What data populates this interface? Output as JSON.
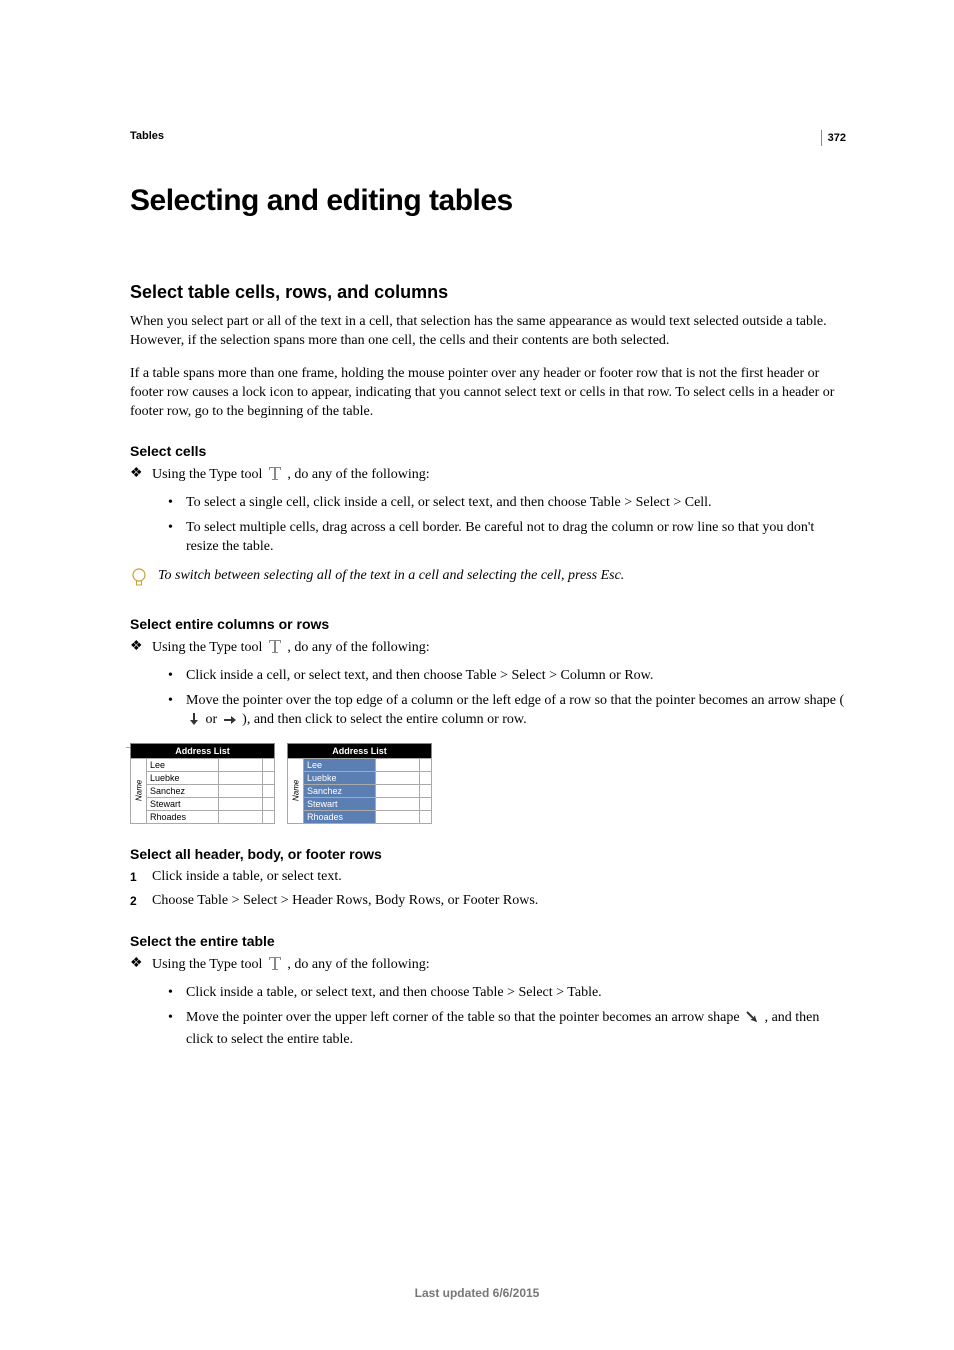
{
  "page_number": "372",
  "breadcrumb": "Tables",
  "h1": "Selecting and editing tables",
  "h2": "Select table cells, rows, and columns",
  "intro_p1": "When you select part or all of the text in a cell, that selection has the same appearance as would text selected outside a table. However, if the selection spans more than one cell, the cells and their contents are both selected.",
  "intro_p2": "If a table spans more than one frame, holding the mouse pointer over any header or footer row that is not the first header or footer row causes a lock icon to appear, indicating that you cannot select text or cells in that row. To select cells in a header or footer row, go to the beginning of the table.",
  "sections": {
    "select_cells": {
      "title": "Select cells",
      "lead_pre": "Using the Type tool ",
      "lead_post": " , do any of the following:",
      "b1": "To select a single cell, click inside a cell, or select text, and then choose Table > Select > Cell.",
      "b2": "To select multiple cells, drag across a cell border. Be careful not to drag the column or row line so that you don't resize the table.",
      "tip": "To switch between selecting all of the text in a cell and selecting the cell, press Esc."
    },
    "select_cols_rows": {
      "title": "Select entire columns or rows",
      "lead_pre": "Using the Type tool ",
      "lead_post": " , do any of the following:",
      "b1": "Click inside a cell, or select text, and then choose Table > Select > Column or Row.",
      "b2_pre": "Move the pointer over the top edge of a column or the left edge of a row so that the pointer becomes an arrow shape ( ",
      "b2_mid": " or ",
      "b2_post": " ), and then click to select the entire column or row."
    },
    "select_header_body_footer": {
      "title": "Select all header, body, or footer rows",
      "s1": "Click inside a table, or select text.",
      "s2": "Choose Table > Select > Header Rows, Body Rows, or Footer Rows."
    },
    "select_entire_table": {
      "title": "Select the entire table",
      "lead_pre": "Using the Type tool ",
      "lead_post": " , do any of the following:",
      "b1": "Click inside a table, or select text, and then choose Table > Select > Table.",
      "b2_pre": "Move the pointer over the upper left corner of the table so that the pointer becomes an arrow shape ",
      "b2_post": " , and then click to select the entire table."
    }
  },
  "sample_table": {
    "header": "Address List",
    "row_label": "Name",
    "rows": [
      "Lee",
      "Luebke",
      "Sanchez",
      "Stewart",
      "Rhoades"
    ]
  },
  "footer": "Last updated 6/6/2015"
}
